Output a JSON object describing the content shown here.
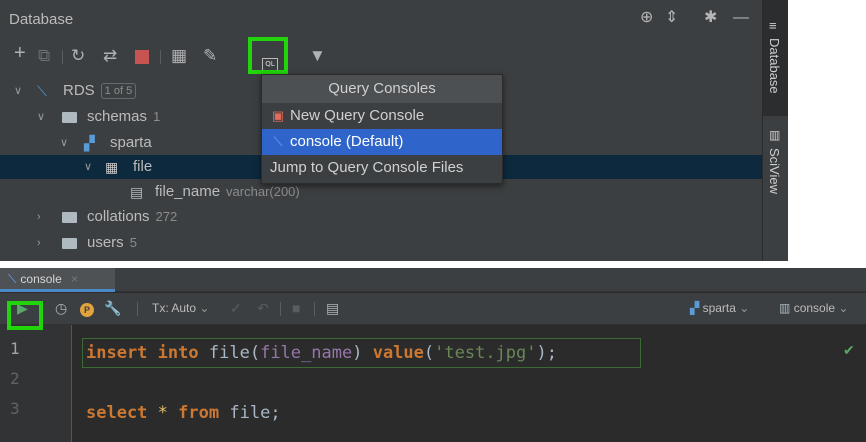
{
  "db_panel": {
    "title": "Database",
    "tree": [
      {
        "label": "RDS",
        "badge": "1 of 5"
      },
      {
        "label": "schemas",
        "count": "1"
      },
      {
        "label": "sparta"
      },
      {
        "label": "file"
      },
      {
        "label": "file_name",
        "type": "varchar(200)"
      },
      {
        "label": "collations",
        "count": "272"
      },
      {
        "label": "users",
        "count": "5"
      }
    ]
  },
  "dropdown": {
    "title": "Query Consoles",
    "items": [
      "New Query Console",
      "console (Default)",
      "Jump to Query Console Files"
    ]
  },
  "side_strip": {
    "database": "Database",
    "sciview": "SciView"
  },
  "editor": {
    "tab_label": "console",
    "tx_label": "Tx: Auto",
    "schema_label": "sparta",
    "console_label": "console",
    "line_numbers": [
      "1",
      "2",
      "3"
    ],
    "line1": {
      "kw1": "insert",
      "kw2": "into",
      "table": "file",
      "open": "(",
      "col": "file_name",
      "close": ")",
      "kw3": "value",
      "open2": "(",
      "str": "'test.jpg'",
      "close2": ");"
    },
    "line3": {
      "kw1": "select",
      "star": "*",
      "kw2": "from",
      "table": "file",
      "semi": ";"
    }
  },
  "colors": {
    "highlight": "#22d40a",
    "selection": "#2f65ca",
    "keyword": "#cc7832",
    "string": "#6a8759",
    "field": "#9876aa"
  }
}
